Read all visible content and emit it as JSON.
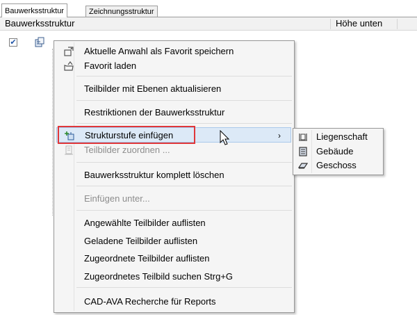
{
  "tabs": [
    {
      "label": "Bauwerksstruktur",
      "active": true
    },
    {
      "label": "Zeichnungsstruktur",
      "active": false
    }
  ],
  "columns": {
    "name_header": "Bauwerksstruktur",
    "height_header": "Höhe unten"
  },
  "tree": {
    "root_checked": true,
    "check_glyph": "✔",
    "root_icon": "building-structure-icon"
  },
  "context_menu": {
    "items": [
      {
        "label": "Aktuelle Anwahl als Favorit speichern",
        "icon": "save-favorite-icon",
        "enabled": true
      },
      {
        "label": "Favorit laden",
        "icon": "load-favorite-icon",
        "enabled": true
      },
      {
        "label": "Teilbilder mit Ebenen aktualisieren",
        "enabled": true
      },
      {
        "label": "Restriktionen der Bauwerksstruktur",
        "enabled": true
      },
      {
        "label": "Strukturstufe einfügen",
        "icon": "insert-structure-level-icon",
        "enabled": true,
        "submenu_arrow": "›",
        "highlighted": true
      },
      {
        "label": "Teilbilder zuordnen ...",
        "icon": "assign-drawing-files-icon",
        "enabled": false
      },
      {
        "label": "Bauwerksstruktur komplett löschen",
        "enabled": true
      },
      {
        "label": "Einfügen unter...",
        "enabled": false
      },
      {
        "label": "Angewählte Teilbilder auflisten",
        "enabled": true
      },
      {
        "label": "Geladene Teilbilder auflisten",
        "enabled": true
      },
      {
        "label": "Zugeordnete Teilbilder auflisten",
        "enabled": true
      },
      {
        "label": "Zugeordnetes Teilbild suchen Strg+G",
        "enabled": true
      },
      {
        "label": "CAD-AVA Recherche für Reports",
        "enabled": true
      }
    ]
  },
  "submenu": {
    "items": [
      {
        "label": "Liegenschaft",
        "icon": "property-icon"
      },
      {
        "label": "Gebäude",
        "icon": "building-icon"
      },
      {
        "label": "Geschoss",
        "icon": "floor-icon"
      }
    ]
  },
  "colors": {
    "highlight_border": "#e0373a",
    "hover_background": "#dce9f7",
    "menu_background": "#f5f5f5",
    "disabled_text": "#8d8d8d"
  }
}
